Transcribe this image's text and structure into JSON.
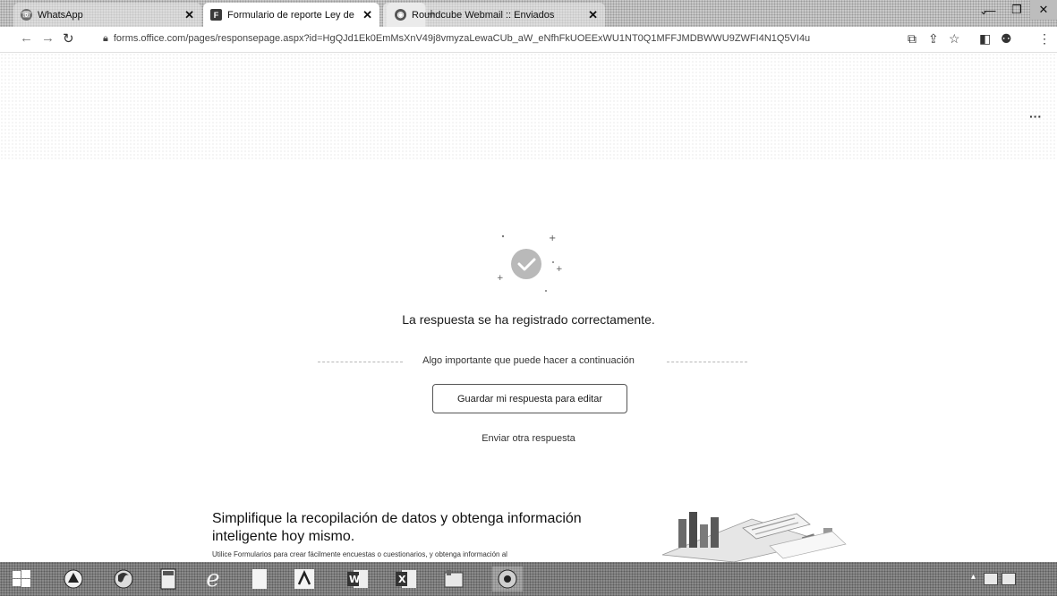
{
  "browser": {
    "tabs": [
      {
        "label": "WhatsApp",
        "icon": "whatsapp-icon",
        "icon_color": "#6d6d6d",
        "active": false
      },
      {
        "label": "Formulario de reporte Ley de En",
        "icon": "forms-icon",
        "icon_color": "#3a3a3a",
        "active": true
      },
      {
        "label": "Roundcube Webmail :: Enviados",
        "icon": "roundcube-icon",
        "icon_color": "#555555",
        "active": false
      }
    ],
    "url": "forms.office.com/pages/responsepage.aspx?id=HgQJd1Ek0EmMsXnV49j8vmyzaLewaCUb_aW_eNfhFkUOEExWU1NT0Q1MFFJMDBWWU9ZWFI4N1Q5VI4u"
  },
  "page": {
    "success_message": "La respuesta se ha registrado correctamente.",
    "next_steps_text": "Algo importante que puede hacer a continuación",
    "save_button_label": "Guardar mi respuesta para editar",
    "send_another_label": "Enviar otra respuesta",
    "promo_title": "Simplifique la recopilación de datos y obtenga información inteligente hoy mismo.",
    "promo_description": "Utilice Formularios para crear fácilmente encuestas o cuestionarios, y obtenga información al"
  },
  "taskbar": {
    "apps": [
      "start-icon",
      "chrome-canary-icon",
      "firefox-icon",
      "calculator-icon",
      "internet-explorer-icon",
      "file-icon",
      "acrobat-icon",
      "word-icon",
      "excel-icon",
      "paint-icon",
      "chrome-icon"
    ]
  },
  "colors": {
    "success_circle": "#b9b9b9",
    "button_border": "#555555"
  }
}
